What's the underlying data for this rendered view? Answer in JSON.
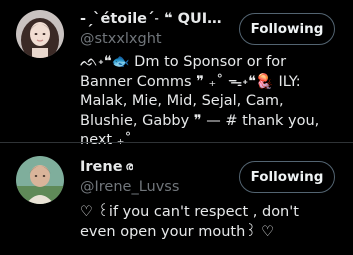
{
  "users": [
    {
      "display_name": "-ˏˋétoileˊ˗ ❝ QUICK ...",
      "handle": "@stxxlxght",
      "follow_label": "Following",
      "bio": "ᨒ˖❝🐟 Dm to Sponsor or for Banner Comms ❞ ₊˚ ᯓ˖❝🪼 ILY: Malak, Mie, Mid, Sejal, Cam, Blushie, Gabby ❞ — # thank you, next ₊˚",
      "avatar_icon": "profile-photo-girl"
    },
    {
      "display_name": "Irene",
      "name_badge": "ര",
      "handle": "@Irene_Luvss",
      "follow_label": "Following",
      "bio": "♡ ꒰if you can't respect , don't even open your mouth꒱ ♡",
      "avatar_icon": "profile-photo-boy"
    }
  ],
  "colors": {
    "background": "#000000",
    "text": "#e7e9ea",
    "secondary_text": "#71767b",
    "button_border": "#536471",
    "divider": "#2f3336"
  }
}
